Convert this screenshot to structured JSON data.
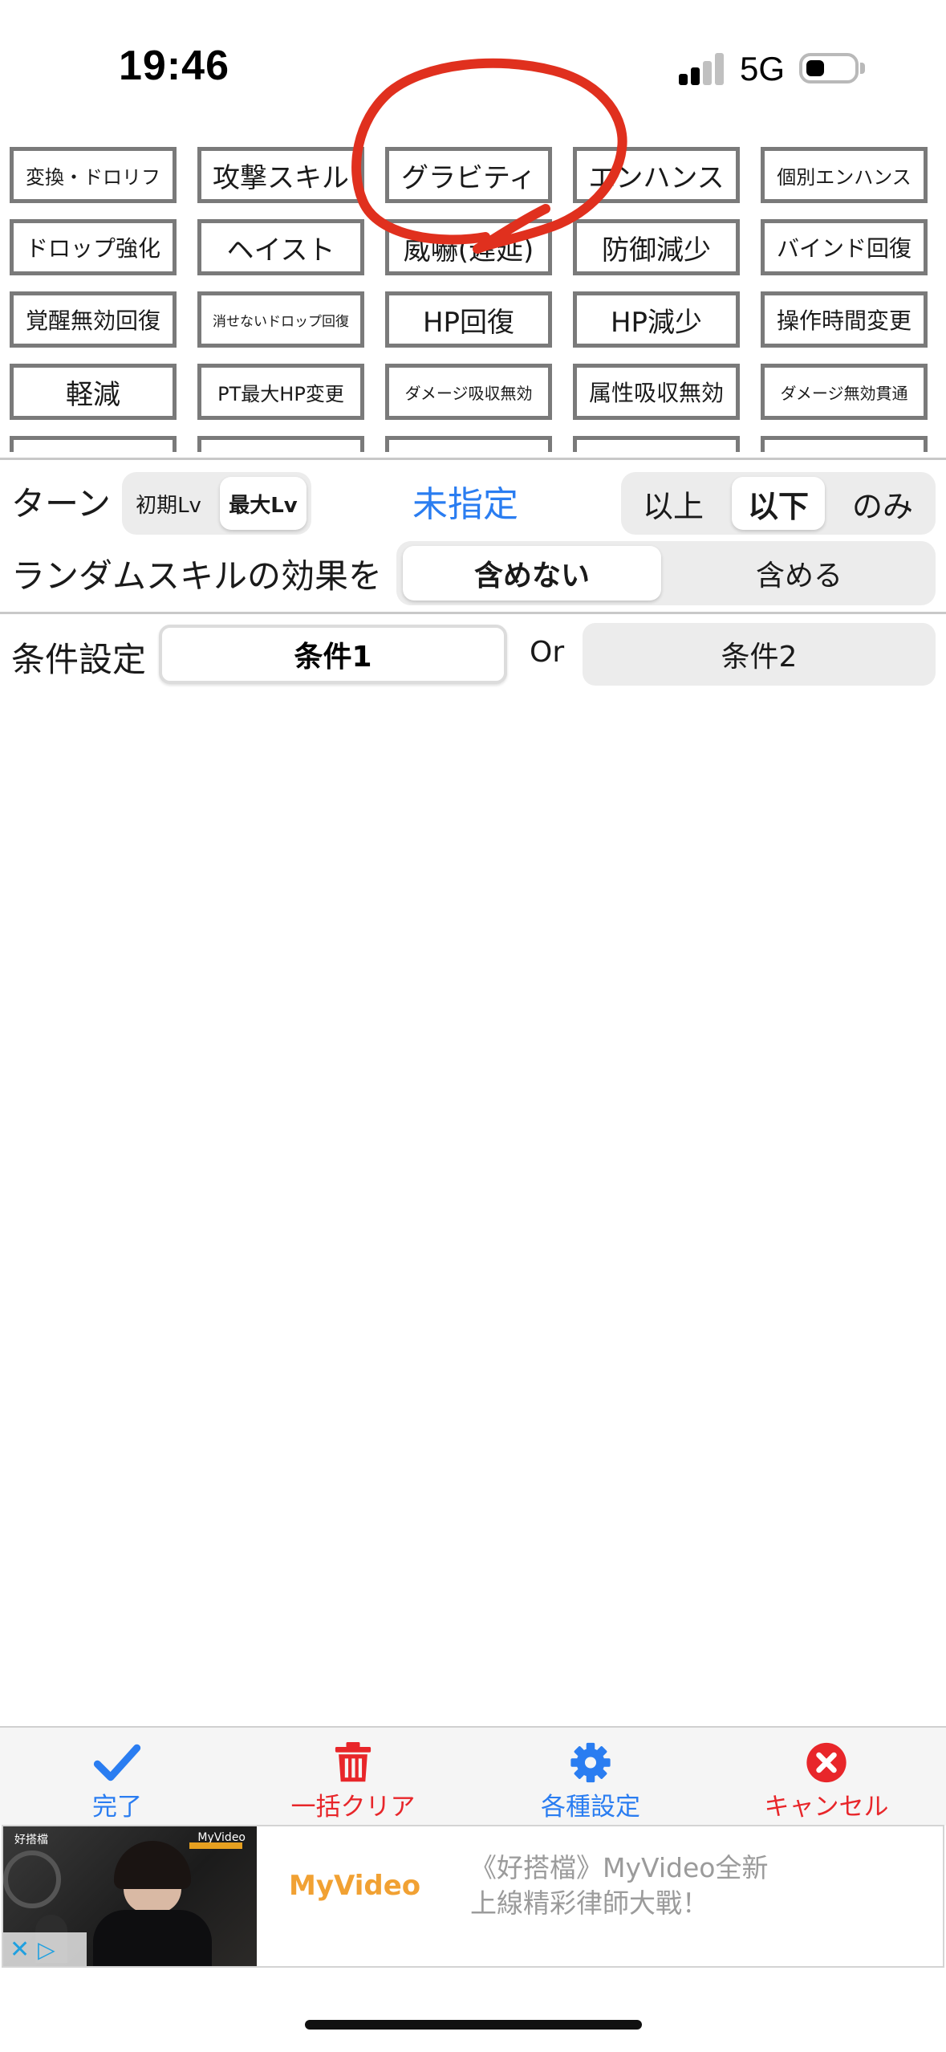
{
  "status_bar": {
    "time": "19:46",
    "network": "5G"
  },
  "skills": [
    [
      "変換・ドロリフ",
      "攻撃スキル",
      "グラビティ",
      "エンハンス",
      "個別エンハンス"
    ],
    [
      "ドロップ強化",
      "ヘイスト",
      "威嚇(遅延)",
      "防御減少",
      "バインド回復"
    ],
    [
      "覚醒無効回復",
      "消せないドロップ回復",
      "HP回復",
      "HP減少",
      "操作時間変更"
    ],
    [
      "軽減",
      "PT最大HP変更",
      "ダメージ吸収無効",
      "属性吸収無効",
      "ダメージ無効貫通"
    ]
  ],
  "turn": {
    "label": "ターン",
    "lv_options": [
      "初期Lv",
      "最大Lv"
    ],
    "lv_selected": "最大Lv",
    "value": "未指定",
    "compare_options": [
      "以上",
      "以下",
      "のみ"
    ],
    "compare_selected": "以下"
  },
  "random_skill": {
    "label": "ランダムスキルの効果を",
    "options": [
      "含めない",
      "含める"
    ],
    "selected": "含めない"
  },
  "condition": {
    "label": "条件設定",
    "cond1": "条件1",
    "or": "Or",
    "cond2": "条件2"
  },
  "toolbar": {
    "done": "完了",
    "clear_all": "一括クリア",
    "settings": "各種設定",
    "cancel": "キャンセル"
  },
  "ad": {
    "thumb_brand": "MyVideo",
    "thumb_tag": "好搭檔",
    "brand": "MyVideo",
    "text_line1": "《好搭檔》MyVideo全新",
    "text_line2": "上線精彩律師大戰！"
  },
  "colors": {
    "accent_blue": "#2a7df1",
    "danger_red": "#e8262a",
    "annotation_red": "#e0301e",
    "cell_border": "#7a7a7a"
  }
}
